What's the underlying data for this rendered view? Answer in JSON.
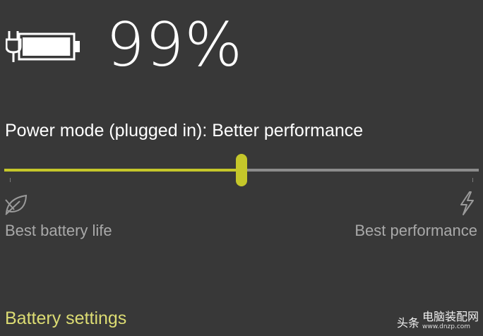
{
  "battery": {
    "percent_text": "99%",
    "level": 0.99,
    "charging": true,
    "icon": "battery-charging-icon"
  },
  "power_mode": {
    "label": "Power mode (plugged in): Better performance",
    "slider_value": 0.5,
    "min_label": "Best battery life",
    "max_label": "Best performance",
    "min_icon": "leaf-icon",
    "max_icon": "lightning-bolt-icon"
  },
  "links": {
    "battery_settings": "Battery settings"
  },
  "watermark": {
    "text": "头条",
    "brand": "电脑装配网",
    "domain": "www.dnzp.com"
  },
  "colors": {
    "background": "#383838",
    "accent": "#c5c72a",
    "link": "#dcdc73",
    "track": "#8c8c8c",
    "muted_text": "#a9a9a9"
  }
}
